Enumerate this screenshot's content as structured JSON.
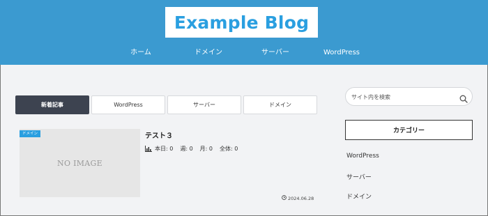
{
  "site": {
    "logo": "Example Blog"
  },
  "nav": {
    "items": [
      "ホーム",
      "ドメイン",
      "サーバー",
      "WordPress"
    ]
  },
  "tabs": {
    "items": [
      "新着記事",
      "WordPress",
      "サーバー",
      "ドメイン"
    ],
    "active": "新着記事"
  },
  "post": {
    "category": "ドメイン",
    "thumbnail_text": "NO IMAGE",
    "title": "テスト３",
    "views": {
      "today": "本日: 0",
      "week": "週: 0",
      "month": "月: 0",
      "total": "全体: 0"
    },
    "date": "2024.06.28"
  },
  "sidebar": {
    "search_placeholder": "サイト内を検索",
    "category_heading": "カテゴリー",
    "categories": [
      "WordPress",
      "サーバー",
      "ドメイン"
    ]
  },
  "colors": {
    "header": "#3b9ad0",
    "accent": "#2a9fe0",
    "active_tab": "#3d4350"
  },
  "icons": {
    "search": "search-icon",
    "views": "bar-chart-icon",
    "date": "clock-icon"
  }
}
